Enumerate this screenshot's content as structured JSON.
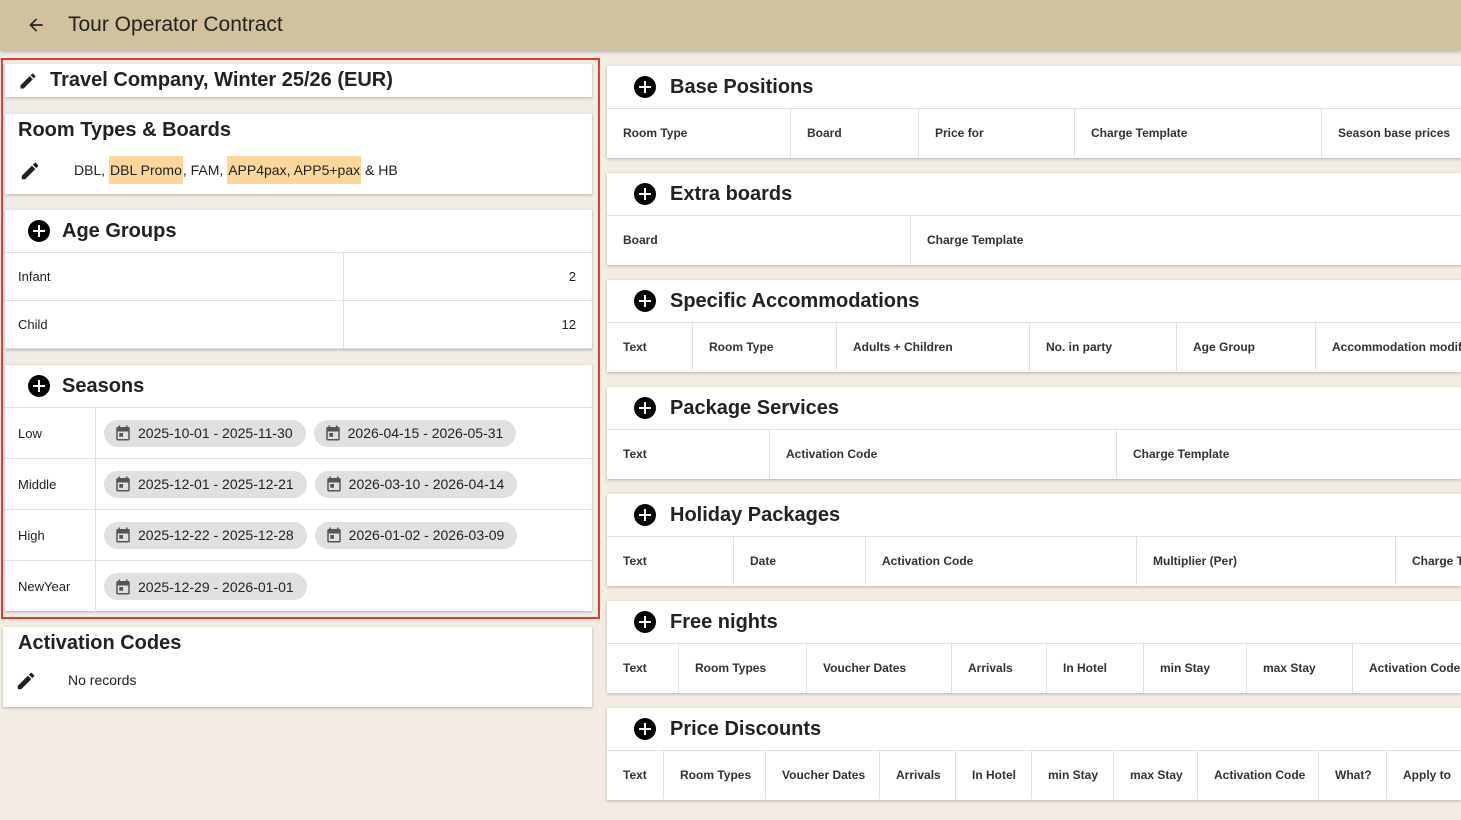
{
  "appbar": {
    "title": "Tour Operator Contract"
  },
  "contract": {
    "title": "Travel Company, Winter 25/26 (EUR)"
  },
  "room_types_boards": {
    "heading": "Room Types & Boards",
    "parts": [
      {
        "text": "DBL, ",
        "highlight": false
      },
      {
        "text": "DBL Promo",
        "highlight": true
      },
      {
        "text": ", FAM, ",
        "highlight": false
      },
      {
        "text": "APP4pax, APP5+pax",
        "highlight": true
      },
      {
        "text": " & HB",
        "highlight": false
      }
    ]
  },
  "age_groups": {
    "heading": "Age Groups",
    "rows": [
      {
        "name": "Infant",
        "value": "2"
      },
      {
        "name": "Child",
        "value": "12"
      }
    ]
  },
  "seasons": {
    "heading": "Seasons",
    "rows": [
      {
        "name": "Low",
        "ranges": [
          "2025-10-01 - 2025-11-30",
          "2026-04-15 - 2026-05-31"
        ]
      },
      {
        "name": "Middle",
        "ranges": [
          "2025-12-01 - 2025-12-21",
          "2026-03-10 - 2026-04-14"
        ]
      },
      {
        "name": "High",
        "ranges": [
          "2025-12-22 - 2025-12-28",
          "2026-01-02 - 2026-03-09"
        ]
      },
      {
        "name": "NewYear",
        "ranges": [
          "2025-12-29 - 2026-01-01"
        ]
      }
    ]
  },
  "activation_codes": {
    "heading": "Activation Codes",
    "empty_text": "No records"
  },
  "right_cards": [
    {
      "heading": "Base Positions",
      "columns": [
        "Room Type",
        "Board",
        "Price for",
        "Charge Template",
        "Season base prices"
      ]
    },
    {
      "heading": "Extra boards",
      "columns": [
        "Board",
        "Charge Template"
      ]
    },
    {
      "heading": "Specific Accommodations",
      "columns": [
        "Text",
        "Room Type",
        "Adults + Children",
        "No. in party",
        "Age Group",
        "Accommodation modifi"
      ]
    },
    {
      "heading": "Package Services",
      "columns": [
        "Text",
        "Activation Code",
        "Charge Template"
      ]
    },
    {
      "heading": "Holiday Packages",
      "columns": [
        "Text",
        "Date",
        "Activation Code",
        "Multiplier (Per)",
        "Charge T"
      ]
    },
    {
      "heading": "Free nights",
      "columns": [
        "Text",
        "Room Types",
        "Voucher Dates",
        "Arrivals",
        "In Hotel",
        "min Stay",
        "max Stay",
        "Activation Code"
      ]
    },
    {
      "heading": "Price Discounts",
      "columns": [
        "Text",
        "Room Types",
        "Voucher Dates",
        "Arrivals",
        "In Hotel",
        "min Stay",
        "max Stay",
        "Activation Code",
        "What?",
        "Apply to"
      ]
    }
  ],
  "icons": {
    "back": "arrow-left-icon",
    "edit": "pencil-icon",
    "add": "plus-circle-icon",
    "calendar": "calendar-icon"
  },
  "colors": {
    "appbar": "#d1c19c",
    "background": "#f3ece3",
    "highlight_tag": "#fbd79b",
    "selection_border": "#e53935",
    "chip": "#e0e0e0"
  }
}
